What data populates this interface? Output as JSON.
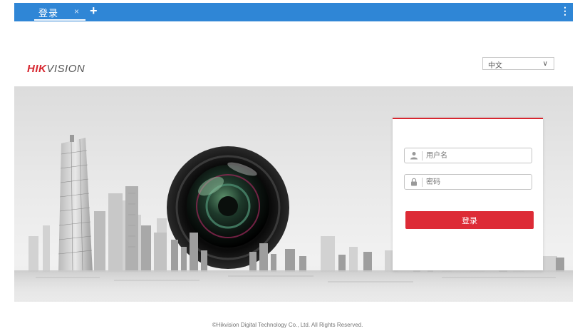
{
  "tab": {
    "title": "登录",
    "close": "×",
    "add": "+",
    "menu": "⋮"
  },
  "logo": {
    "hik": "HIK",
    "vision": "VISION"
  },
  "language": {
    "selected": "中文",
    "chevron": "∨"
  },
  "login": {
    "username_placeholder": "用户名",
    "password_placeholder": "密码",
    "button": "登录"
  },
  "footer": {
    "copyright": "©Hikvision Digital Technology Co., Ltd. All Rights Reserved."
  },
  "colors": {
    "tab_blue": "#2f86d6",
    "brand_red": "#d7262f",
    "button_red": "#dd2b36"
  },
  "icons": [
    "user-icon",
    "lock-icon",
    "close-icon",
    "plus-icon",
    "more-icon",
    "chevron-down-icon"
  ]
}
